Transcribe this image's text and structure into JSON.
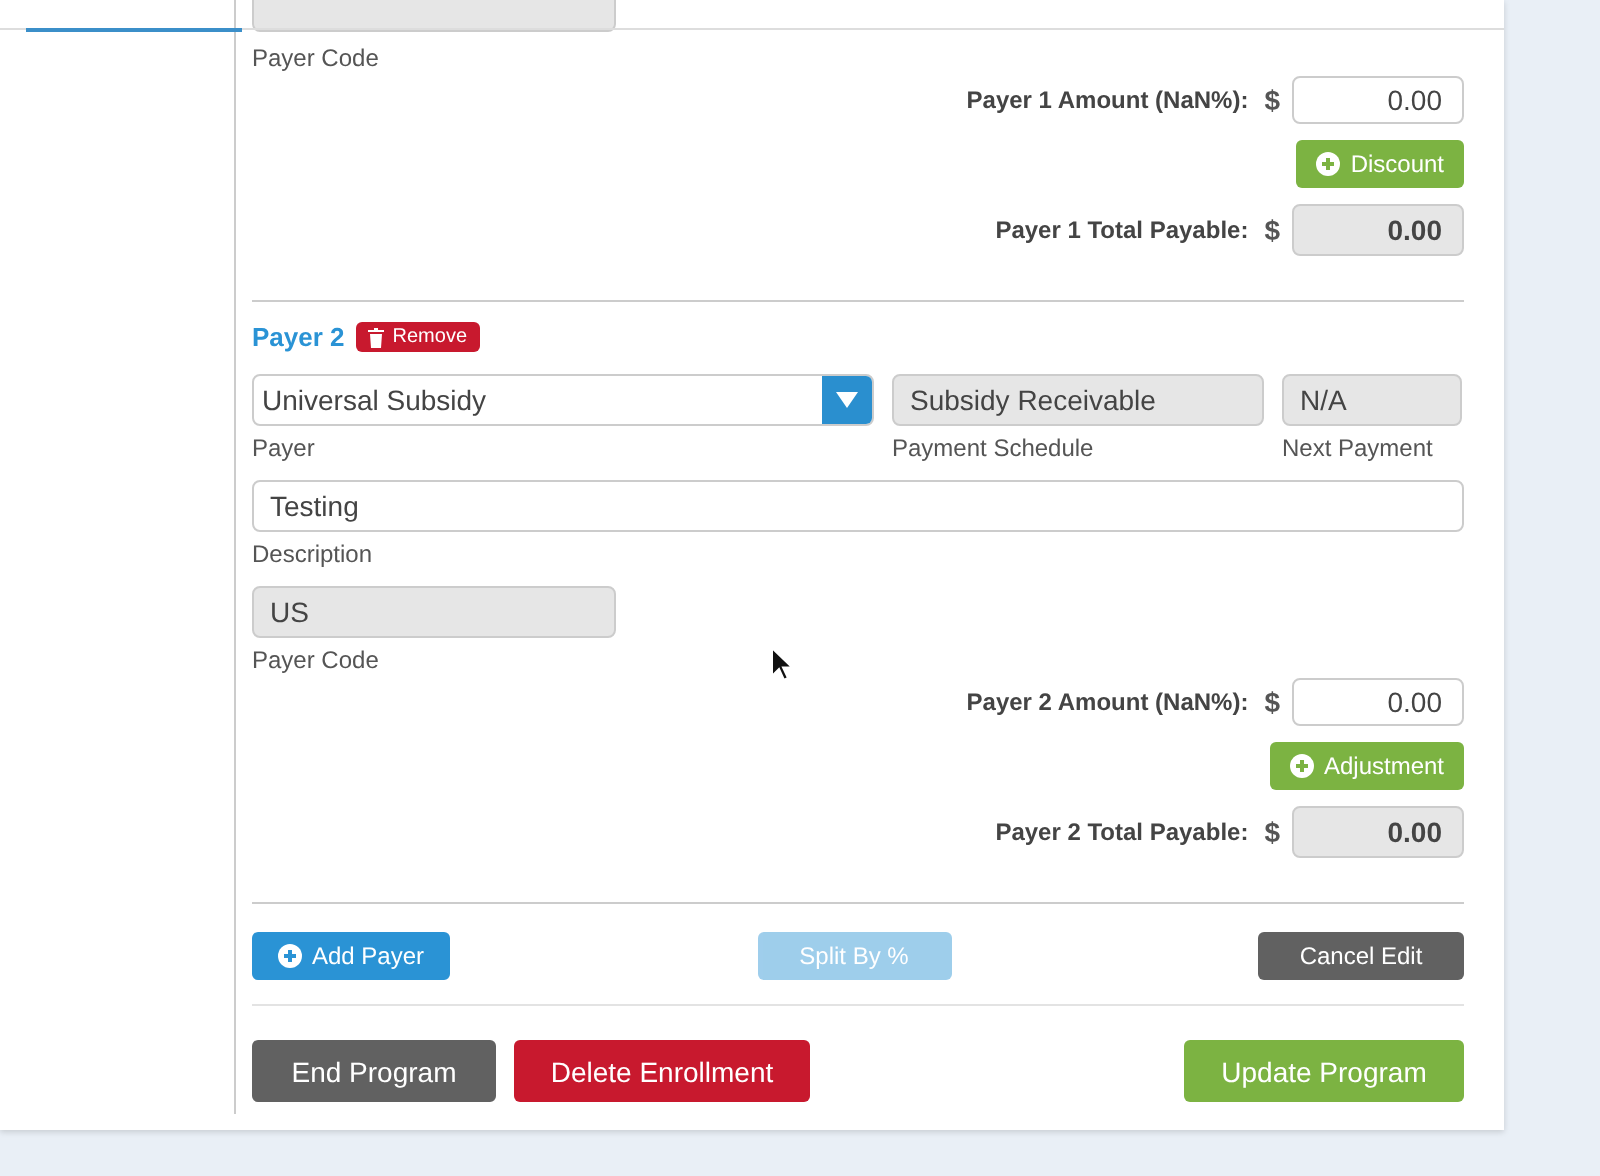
{
  "payers": [
    {
      "kind": "partial",
      "payer_code_label": "Payer Code",
      "amount_label": "Payer 1 Amount (NaN%):",
      "currency": "$",
      "amount": "0.00",
      "action_button": "Discount",
      "total_label": "Payer 1 Total Payable:",
      "total_currency": "$",
      "total": "0.00"
    },
    {
      "kind": "full",
      "title": "Payer 2",
      "remove_button": "Remove",
      "payer": {
        "value": "Universal Subsidy",
        "label": "Payer"
      },
      "payment_schedule": {
        "value": "Subsidy Receivable",
        "label": "Payment Schedule"
      },
      "next_payment": {
        "value": "N/A",
        "label": "Next Payment"
      },
      "description": {
        "value": "Testing",
        "label": "Description"
      },
      "payer_code": {
        "value": "US",
        "label": "Payer Code"
      },
      "amount_label": "Payer 2 Amount (NaN%):",
      "currency": "$",
      "amount": "0.00",
      "action_button": "Adjustment",
      "total_label": "Payer 2 Total Payable:",
      "total_currency": "$",
      "total": "0.00"
    }
  ],
  "actions": [
    {
      "label": "Add Payer",
      "kind": "add",
      "disabled": false
    },
    {
      "label": "Split By %",
      "kind": "split",
      "disabled": true
    },
    {
      "label": "Cancel Edit",
      "kind": "cancel",
      "disabled": false
    }
  ],
  "footer": [
    {
      "label": "End Program",
      "kind": "neutral"
    },
    {
      "label": "Delete Enrollment",
      "kind": "danger"
    },
    {
      "label": "Update Program",
      "kind": "primary"
    }
  ]
}
